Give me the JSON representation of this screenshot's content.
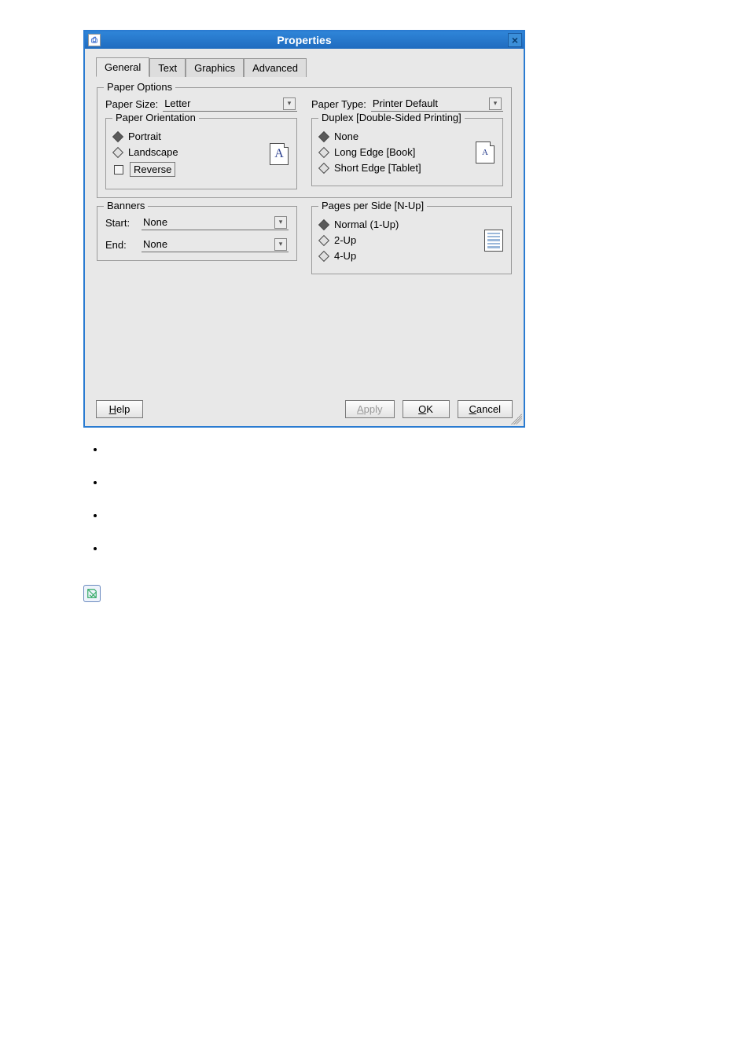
{
  "title": "Properties",
  "tabs": {
    "t0": "General",
    "t1": "Text",
    "t2": "Graphics",
    "t3": "Advanced"
  },
  "paperOptions": {
    "legend": "Paper Options",
    "sizeLabel": "Paper Size:",
    "sizeValue": "Letter",
    "typeLabel": "Paper Type:",
    "typeValue": "Printer Default",
    "orientation": {
      "legend": "Paper Orientation",
      "portrait": "Portrait",
      "landscape": "Landscape",
      "reverse": "Reverse",
      "previewLetter": "A"
    },
    "duplex": {
      "legend": "Duplex [Double-Sided Printing]",
      "none": "None",
      "longEdge": "Long Edge [Book]",
      "shortEdge": "Short Edge [Tablet]",
      "previewLetter": "A"
    }
  },
  "banners": {
    "legend": "Banners",
    "startLabel": "Start:",
    "startValue": "None",
    "endLabel": "End:",
    "endValue": "None"
  },
  "nup": {
    "legend": "Pages per Side [N-Up]",
    "opt1": "Normal (1-Up)",
    "opt2": "2-Up",
    "opt4": "4-Up"
  },
  "buttons": {
    "help": "Help",
    "apply": "Apply",
    "ok": "OK",
    "cancel": "Cancel"
  }
}
